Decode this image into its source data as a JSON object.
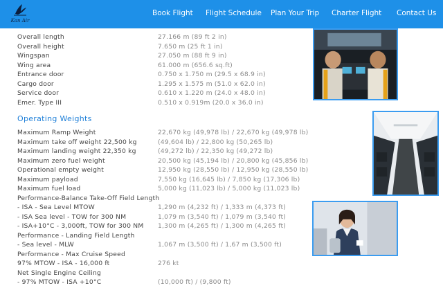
{
  "brand": {
    "logo_text": "Kan Air"
  },
  "nav": [
    "Book Flight",
    "Flight Schedule",
    "Plan Your Trip",
    "Charter Flight",
    "Contact Us"
  ],
  "dimensions": [
    {
      "label": "Overall length",
      "value": "27.166 m (89 ft 2 in)"
    },
    {
      "label": "Overall height",
      "value": "7.650 m (25 ft 1 in)"
    },
    {
      "label": "Wingspan",
      "value": "27.050 m (88 ft 9 in)"
    },
    {
      "label": "Wing area",
      "value": "61.000 m (656.6 sq.ft)"
    },
    {
      "label": "Entrance door",
      "value": "0.750 x 1.750 m (29.5 x 68.9 in)"
    },
    {
      "label": "Cargo door",
      "value": "1.295 x 1.575 m (51.0 x 62.0 in)"
    },
    {
      "label": "Service door",
      "value": "0.610 x 1.220 m (24.0 x 48.0 in)"
    },
    {
      "label": "Emer. Type III",
      "value": "0.510 x 0.919m (20.0 x 36.0 in)"
    }
  ],
  "operating_weights_title": "Operating Weights",
  "weights": [
    {
      "label": "Maximum Ramp Weight",
      "value": "22,670 kg (49,978 lb) / 22,670 kg (49,978 lb)"
    },
    {
      "label": "Maximum take off weight 22,500 kg",
      "value": "(49,604 lb) / 22,800 kg (50,265 lb)"
    },
    {
      "label": "Maximum landing weight 22,350 kg",
      "value": "(49,272 lb) / 22,350 kg (49,272 lb)"
    },
    {
      "label": "Maximum zero fuel weight",
      "value": "20,500 kg (45,194 lb) / 20,800 kg (45,856 lb)"
    },
    {
      "label": "Operational empty weight",
      "value": "12,950 kg (28,550 lb) / 12,950 kg (28,550 lb)"
    },
    {
      "label": "Maximum payload",
      "value": "7,550 kg (16,645 lb) / 7,850 kg (17,306 lb)"
    },
    {
      "label": "Maximum fuel load",
      "value": "5,000 kg (11,023 lb) / 5,000 kg (11,023 lb)"
    },
    {
      "label": "Performance-Balance Take-Off Field Length",
      "value": ""
    },
    {
      "label": "- ISA - Sea Level MTOW",
      "value": "1,290 m (4,232 ft) / 1,333 m (4,373 ft)"
    },
    {
      "label": "- ISA Sea level - TOW for 300 NM",
      "value": "1,079 m (3,540 ft) / 1,079 m (3,540 ft)"
    },
    {
      "label": "- ISA+10°C - 3,000ft, TOW for 300 NM",
      "value": "1,300 m (4,265 ft) / 1,300 m (4,265 ft)"
    },
    {
      "label": "Performance - Landing Field Length",
      "value": ""
    },
    {
      "label": "- Sea level - MLW",
      "value": "1,067 m (3,500 ft) / 1,67 m (3,500 ft)"
    },
    {
      "label": "Performance - Max Cruise Speed",
      "value": ""
    },
    {
      "label": "97% MTOW - ISA - 16,000 ft",
      "value": "276 kt"
    },
    {
      "label": "Net Single Engine Ceiling",
      "value": ""
    },
    {
      "label": "- 97% MTOW - ISA +10°C",
      "value": "(10,000 ft) / (9,800 ft)"
    }
  ],
  "photos": [
    "cockpit-photo",
    "cabin-photo",
    "flight-attendant-photo"
  ]
}
